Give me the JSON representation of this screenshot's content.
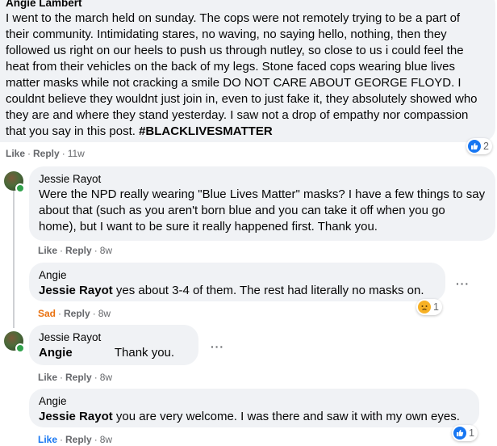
{
  "comments": [
    {
      "author": "Angie Lambert",
      "text": "I went to the march held on sunday. The cops were not remotely trying to be a part of their community. Intimidating stares, no waving, no saying hello, nothing, then they followed us right on our heels to push us through nutley, so close to us i could feel the heat from their vehicles on the back of my legs. Stone faced cops wearing blue lives matter masks while not cracking a smile DO NOT CARE ABOUT GEORGE FLOYD. I couldnt believe they wouldnt just join in, even to just fake it, they absolutely showed who they are and where they stand yesterday. I saw not a drop of empathy nor compassion that you say in this post.",
      "hashtag": "#BLACKLIVESMATTER",
      "actions": {
        "like": "Like",
        "reply": "Reply",
        "time": "11w"
      },
      "reactions": {
        "icon": "like-icon",
        "count": "2"
      }
    },
    {
      "author": "Jessie Rayot",
      "text": "Were the NPD really wearing \"Blue Lives Matter\" masks? I have a few things to say about that (such as you aren't born blue and you can take it off when you go home), but I want to be sure it really happened first. Thank you.",
      "actions": {
        "like": "Like",
        "reply": "Reply",
        "time": "8w"
      }
    },
    {
      "author": "Angie",
      "mention": "Jessie Rayot",
      "text": "yes about 3-4 of them. The rest had literally no masks on.",
      "actions": {
        "like": "Sad",
        "reply": "Reply",
        "time": "8w"
      },
      "reactions": {
        "icon": "sad-icon",
        "count": "1"
      }
    },
    {
      "author": "Jessie Rayot",
      "mention": "Angie",
      "text": "Thank you.",
      "actions": {
        "like": "Like",
        "reply": "Reply",
        "time": "8w"
      }
    },
    {
      "author": "Angie",
      "mention": "Jessie Rayot",
      "text": "you are very welcome. I was there and saw it with my own eyes.",
      "actions": {
        "like": "Like",
        "reply": "Reply",
        "time": "8w"
      },
      "reactions": {
        "icon": "like-icon",
        "count": "1"
      }
    }
  ],
  "more_glyph": "···",
  "colors": {
    "bubble": "#f0f2f5",
    "meta": "#65676b",
    "like_blue": "#1877f2",
    "sad_orange": "#e9710f",
    "online": "#31a24c"
  }
}
